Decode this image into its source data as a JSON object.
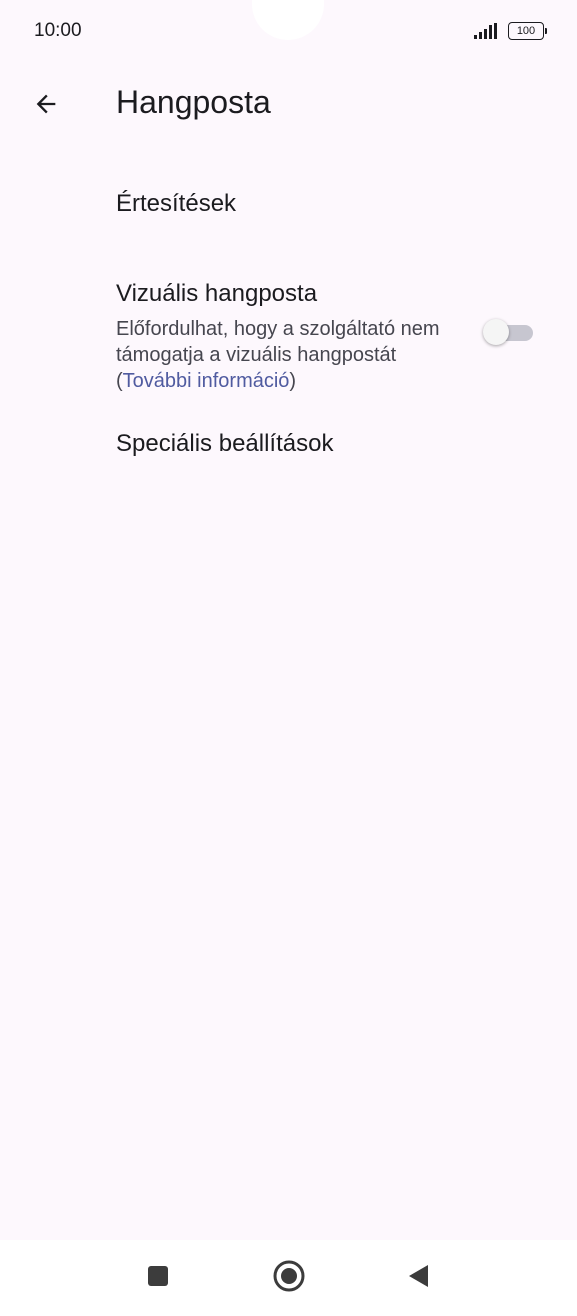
{
  "status_bar": {
    "time": "10:00",
    "battery": "100",
    "icons": [
      "signal-icon",
      "battery-icon"
    ]
  },
  "app_bar": {
    "title": "Hangposta",
    "back_icon": "arrow-left-icon"
  },
  "settings": {
    "notifications": {
      "title": "Értesítések"
    },
    "visual_voicemail": {
      "title": "Vizuális hangposta",
      "summary_text": "Előfordulhat, hogy a szolgáltató nem támogatja a vizuális hangpostát (",
      "learn_more": "További információ",
      "summary_end": ")",
      "enabled": false
    },
    "advanced": {
      "title": "Speciális beállítások"
    }
  },
  "nav_bar": {
    "icons": [
      "square-recents-icon",
      "circle-home-icon",
      "triangle-back-icon"
    ]
  },
  "colors": {
    "background": "#fdf8fd",
    "link": "#505ba0",
    "text": "#1b1b1f",
    "secondary_text": "#46464f"
  }
}
